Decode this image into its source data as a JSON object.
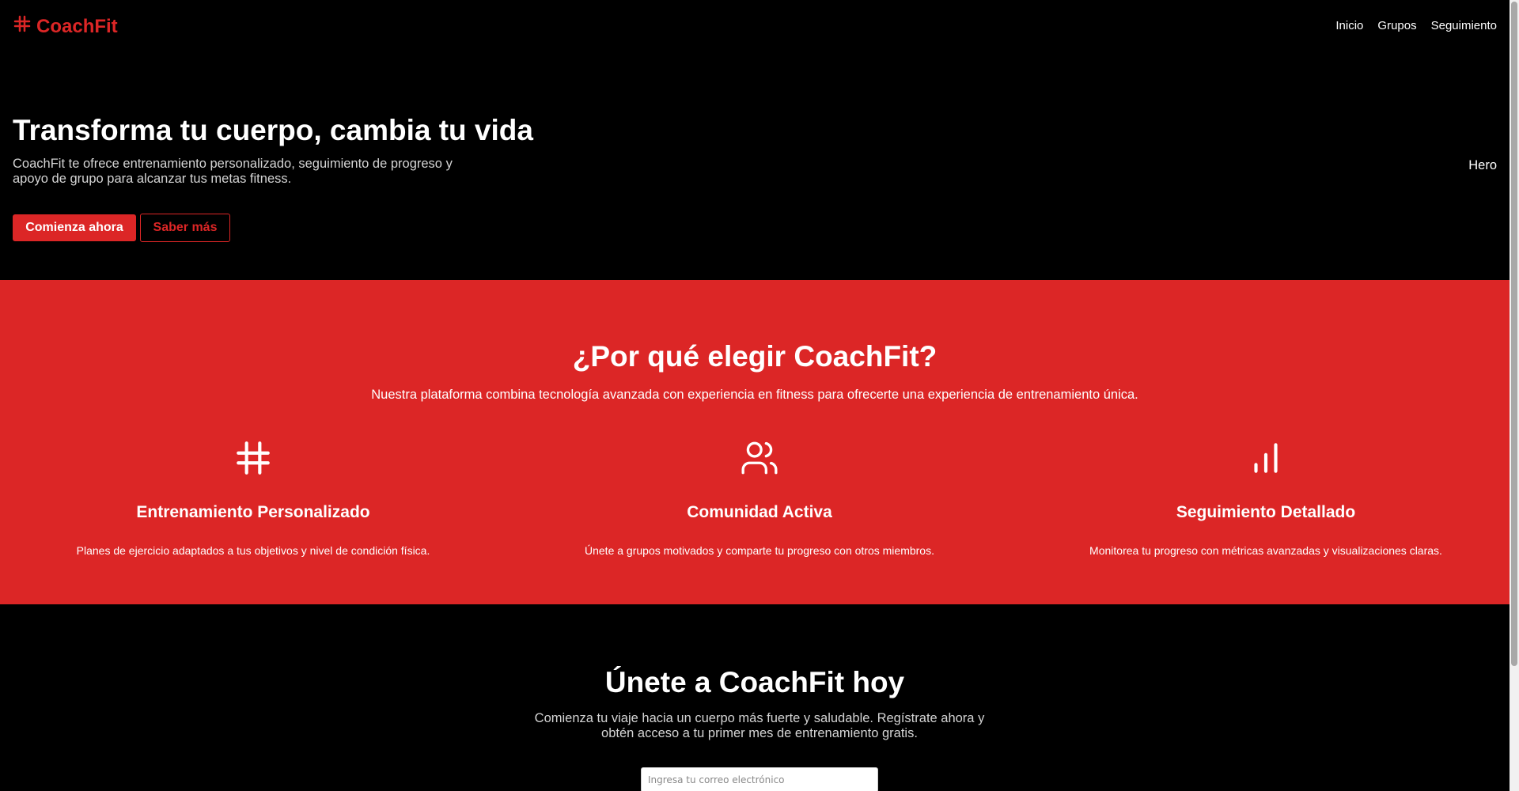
{
  "header": {
    "logo_icon": "hashtag-icon",
    "logo_text": "CoachFit",
    "nav": [
      {
        "label": "Inicio"
      },
      {
        "label": "Grupos"
      },
      {
        "label": "Seguimiento"
      }
    ]
  },
  "hero": {
    "title": "Transforma tu cuerpo, cambia tu vida",
    "description": "CoachFit te ofrece entrenamiento personalizado, seguimiento de progreso y apoyo de grupo para alcanzar tus metas fitness.",
    "side_label": "Hero",
    "primary_button": "Comienza ahora",
    "secondary_button": "Saber más"
  },
  "features": {
    "title": "¿Por qué elegir CoachFit?",
    "subtitle": "Nuestra plataforma combina tecnología avanzada con experiencia en fitness para ofrecerte una experiencia de entrenamiento única.",
    "items": [
      {
        "icon": "hashtag-icon",
        "title": "Entrenamiento Personalizado",
        "description": "Planes de ejercicio adaptados a tus objetivos y nivel de condición física."
      },
      {
        "icon": "users-icon",
        "title": "Comunidad Activa",
        "description": "Únete a grupos motivados y comparte tu progreso con otros miembros."
      },
      {
        "icon": "bar-chart-icon",
        "title": "Seguimiento Detallado",
        "description": "Monitorea tu progreso con métricas avanzadas y visualizaciones claras."
      }
    ]
  },
  "cta": {
    "title": "Únete a CoachFit hoy",
    "description": "Comienza tu viaje hacia un cuerpo más fuerte y saludable. Regístrate ahora y obtén acceso a tu primer mes de entrenamiento gratis.",
    "email_placeholder": "Ingresa tu correo electrónico",
    "email_value": ""
  },
  "colors": {
    "accent": "#dc2626",
    "background": "#000000",
    "text": "#ffffff"
  }
}
